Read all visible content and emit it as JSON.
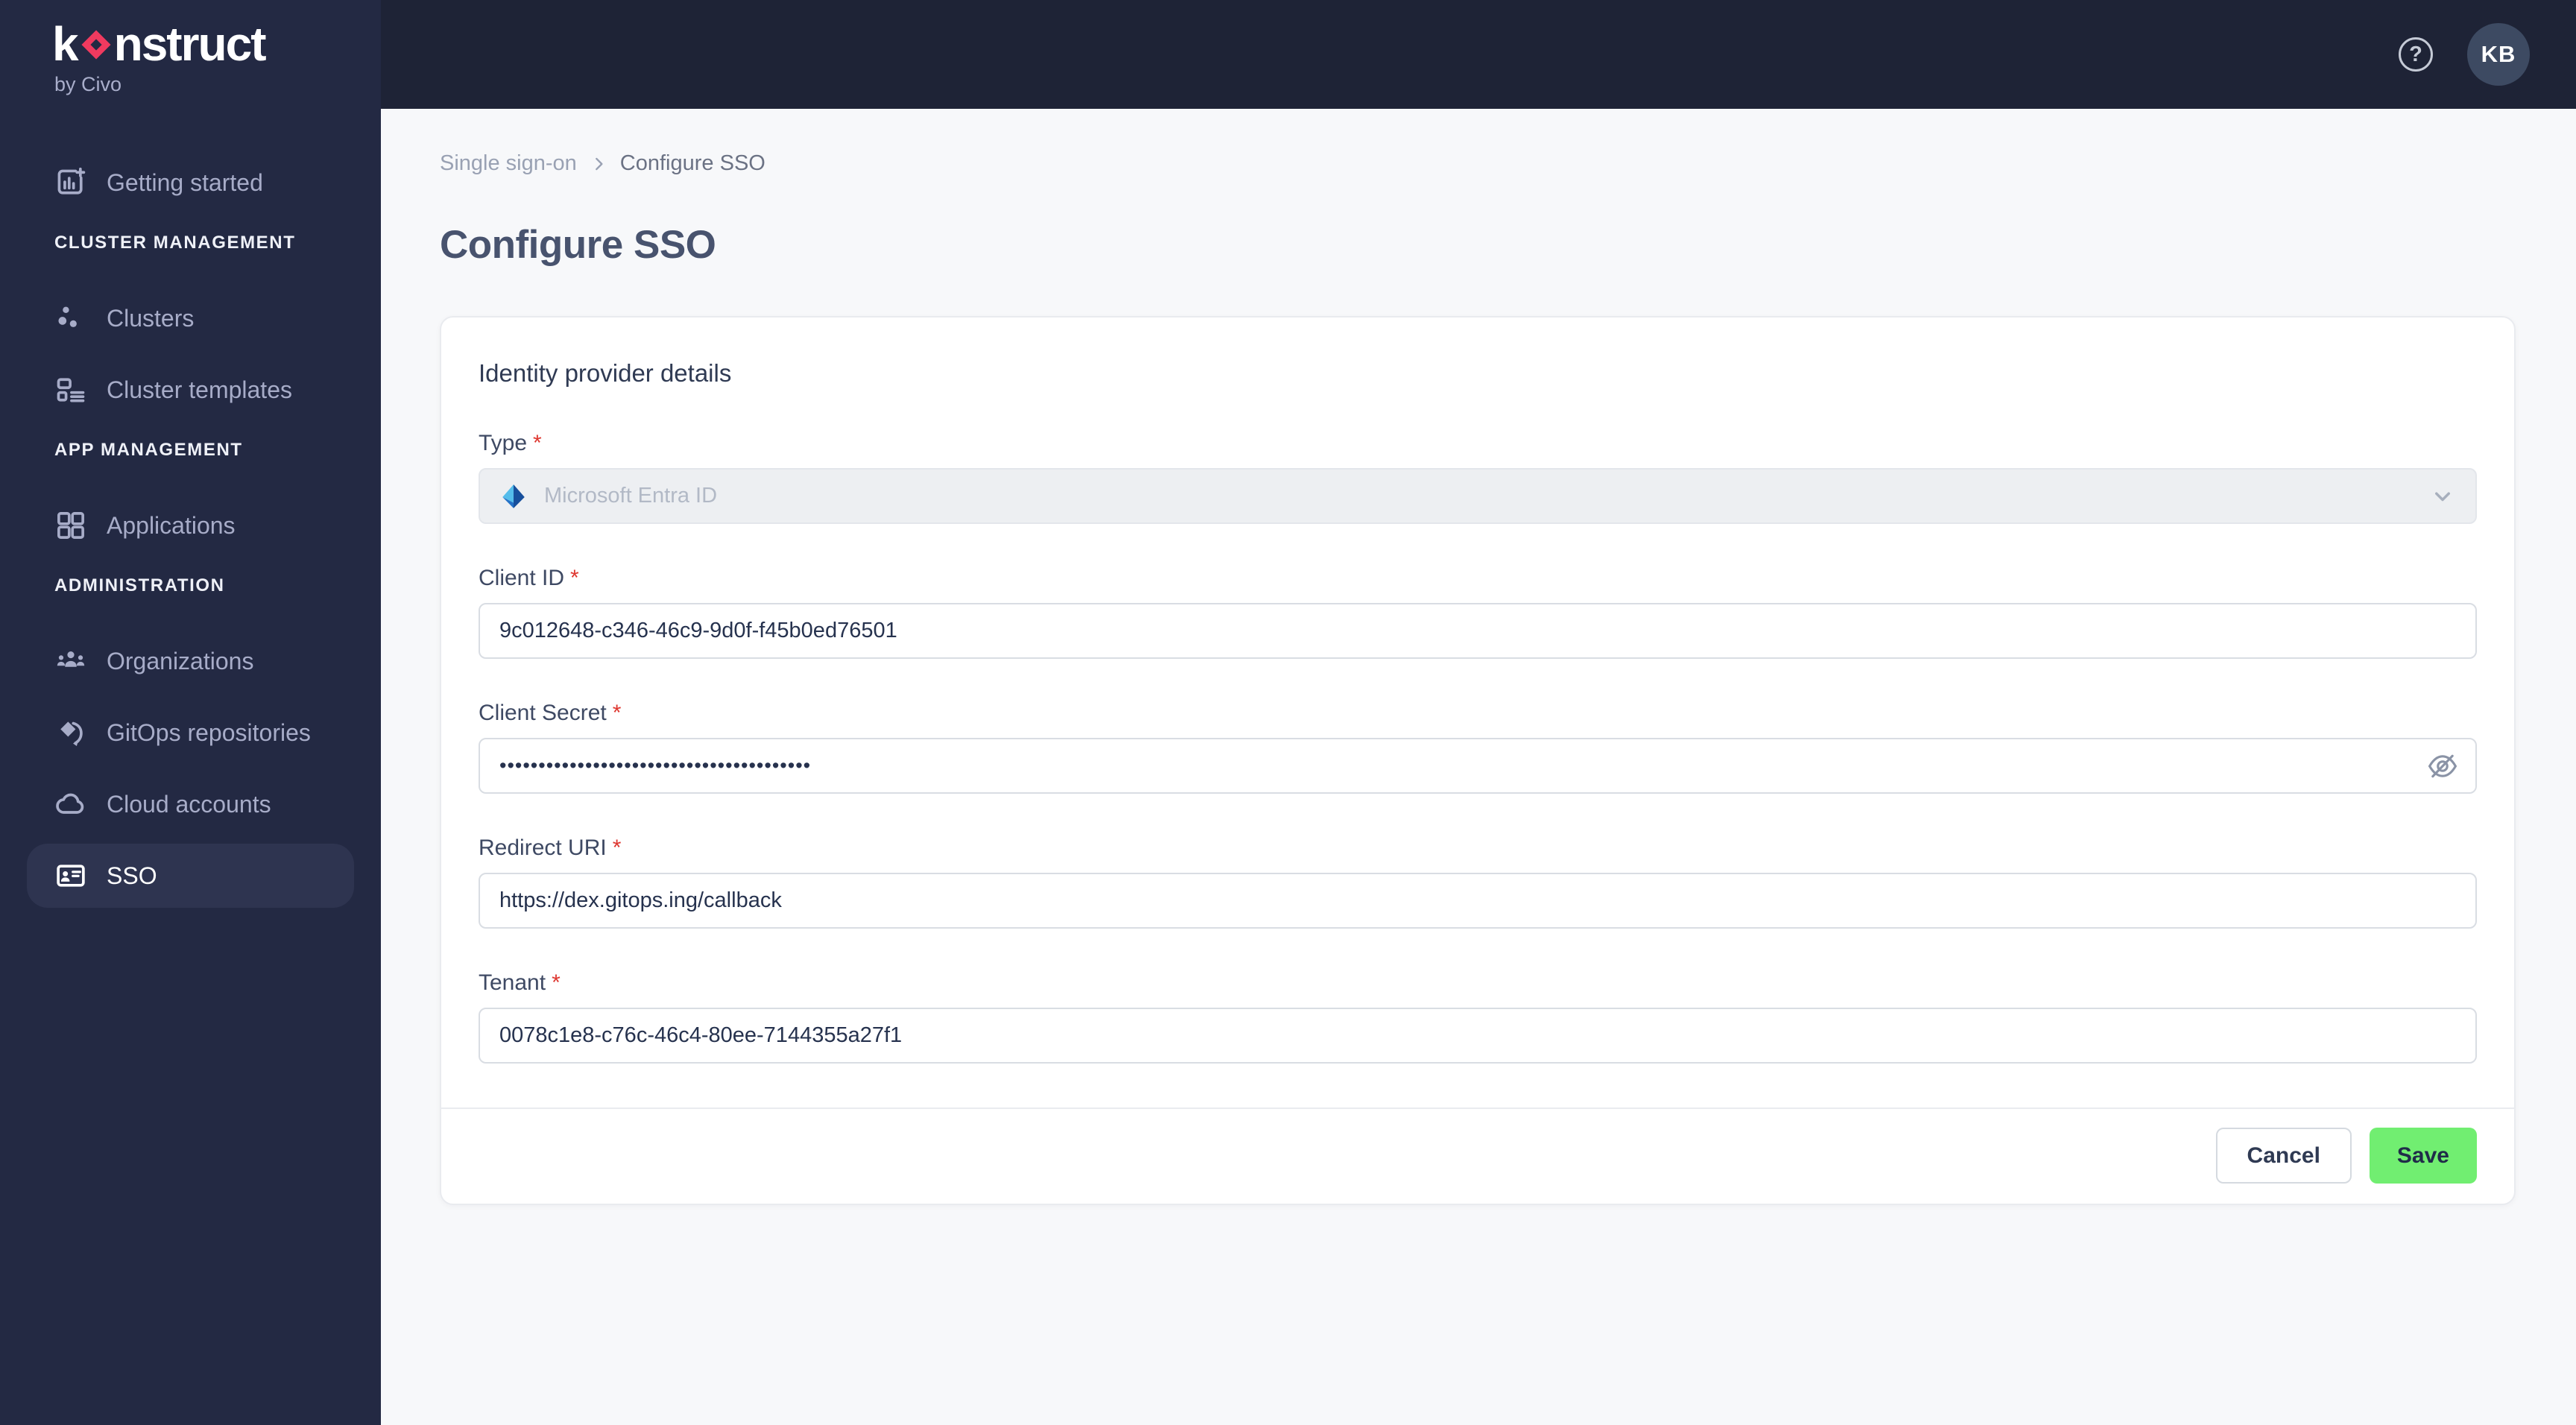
{
  "brand": {
    "logo_pre": "k",
    "logo_post": "nstruct",
    "logo_sub": "by Civo",
    "accent_pink": "#F03A5F"
  },
  "topbar": {
    "help_glyph": "?",
    "avatar_initials": "KB"
  },
  "sidebar": {
    "items": [
      {
        "type": "link",
        "label": "Getting started",
        "icon": "chart-plus-icon"
      },
      {
        "type": "section",
        "label": "CLUSTER MANAGEMENT"
      },
      {
        "type": "link",
        "label": "Clusters",
        "icon": "cluster-dots-icon"
      },
      {
        "type": "link",
        "label": "Cluster templates",
        "icon": "template-icon"
      },
      {
        "type": "section",
        "label": "APP MANAGEMENT"
      },
      {
        "type": "link",
        "label": "Applications",
        "icon": "grid-icon"
      },
      {
        "type": "section",
        "label": "ADMINISTRATION"
      },
      {
        "type": "link",
        "label": "Organizations",
        "icon": "people-icon"
      },
      {
        "type": "link",
        "label": "GitOps repositories",
        "icon": "gitops-icon"
      },
      {
        "type": "link",
        "label": "Cloud accounts",
        "icon": "cloud-icon"
      },
      {
        "type": "link",
        "label": "SSO",
        "icon": "id-card-icon",
        "active": true
      }
    ]
  },
  "breadcrumb": {
    "items": [
      "Single sign-on",
      "Configure SSO"
    ]
  },
  "page": {
    "title": "Configure SSO"
  },
  "form": {
    "section_title": "Identity provider details",
    "fields": [
      {
        "label": "Type",
        "required_mark": "*",
        "control": "select",
        "value": "Microsoft Entra ID",
        "icon": "microsoft-entra-id-logo",
        "disabled": true
      },
      {
        "label": "Client ID",
        "required_mark": "*",
        "control": "input",
        "value": "9c012648-c346-46c9-9d0f-f45b0ed76501"
      },
      {
        "label": "Client Secret",
        "required_mark": "*",
        "control": "password",
        "value": "••••••••••••••••••••••••••••••••••••••••",
        "icon": "eye-off-icon"
      },
      {
        "label": "Redirect URI",
        "required_mark": "*",
        "control": "input",
        "value": "https://dex.gitops.ing/callback"
      },
      {
        "label": "Tenant",
        "required_mark": "*",
        "control": "input",
        "value": "0078c1e8-c76c-46c4-80ee-7144355a27f1"
      }
    ],
    "actions": {
      "cancel": "Cancel",
      "save": "Save"
    }
  },
  "colors": {
    "sidebar_bg": "#232943",
    "topbar_bg": "#1E2336",
    "active_item_bg": "#2E3450",
    "accent_pink": "#F03A5F",
    "save_green": "#71EE71",
    "main_bg": "#F7F8FA",
    "required_red": "#DE3730"
  }
}
